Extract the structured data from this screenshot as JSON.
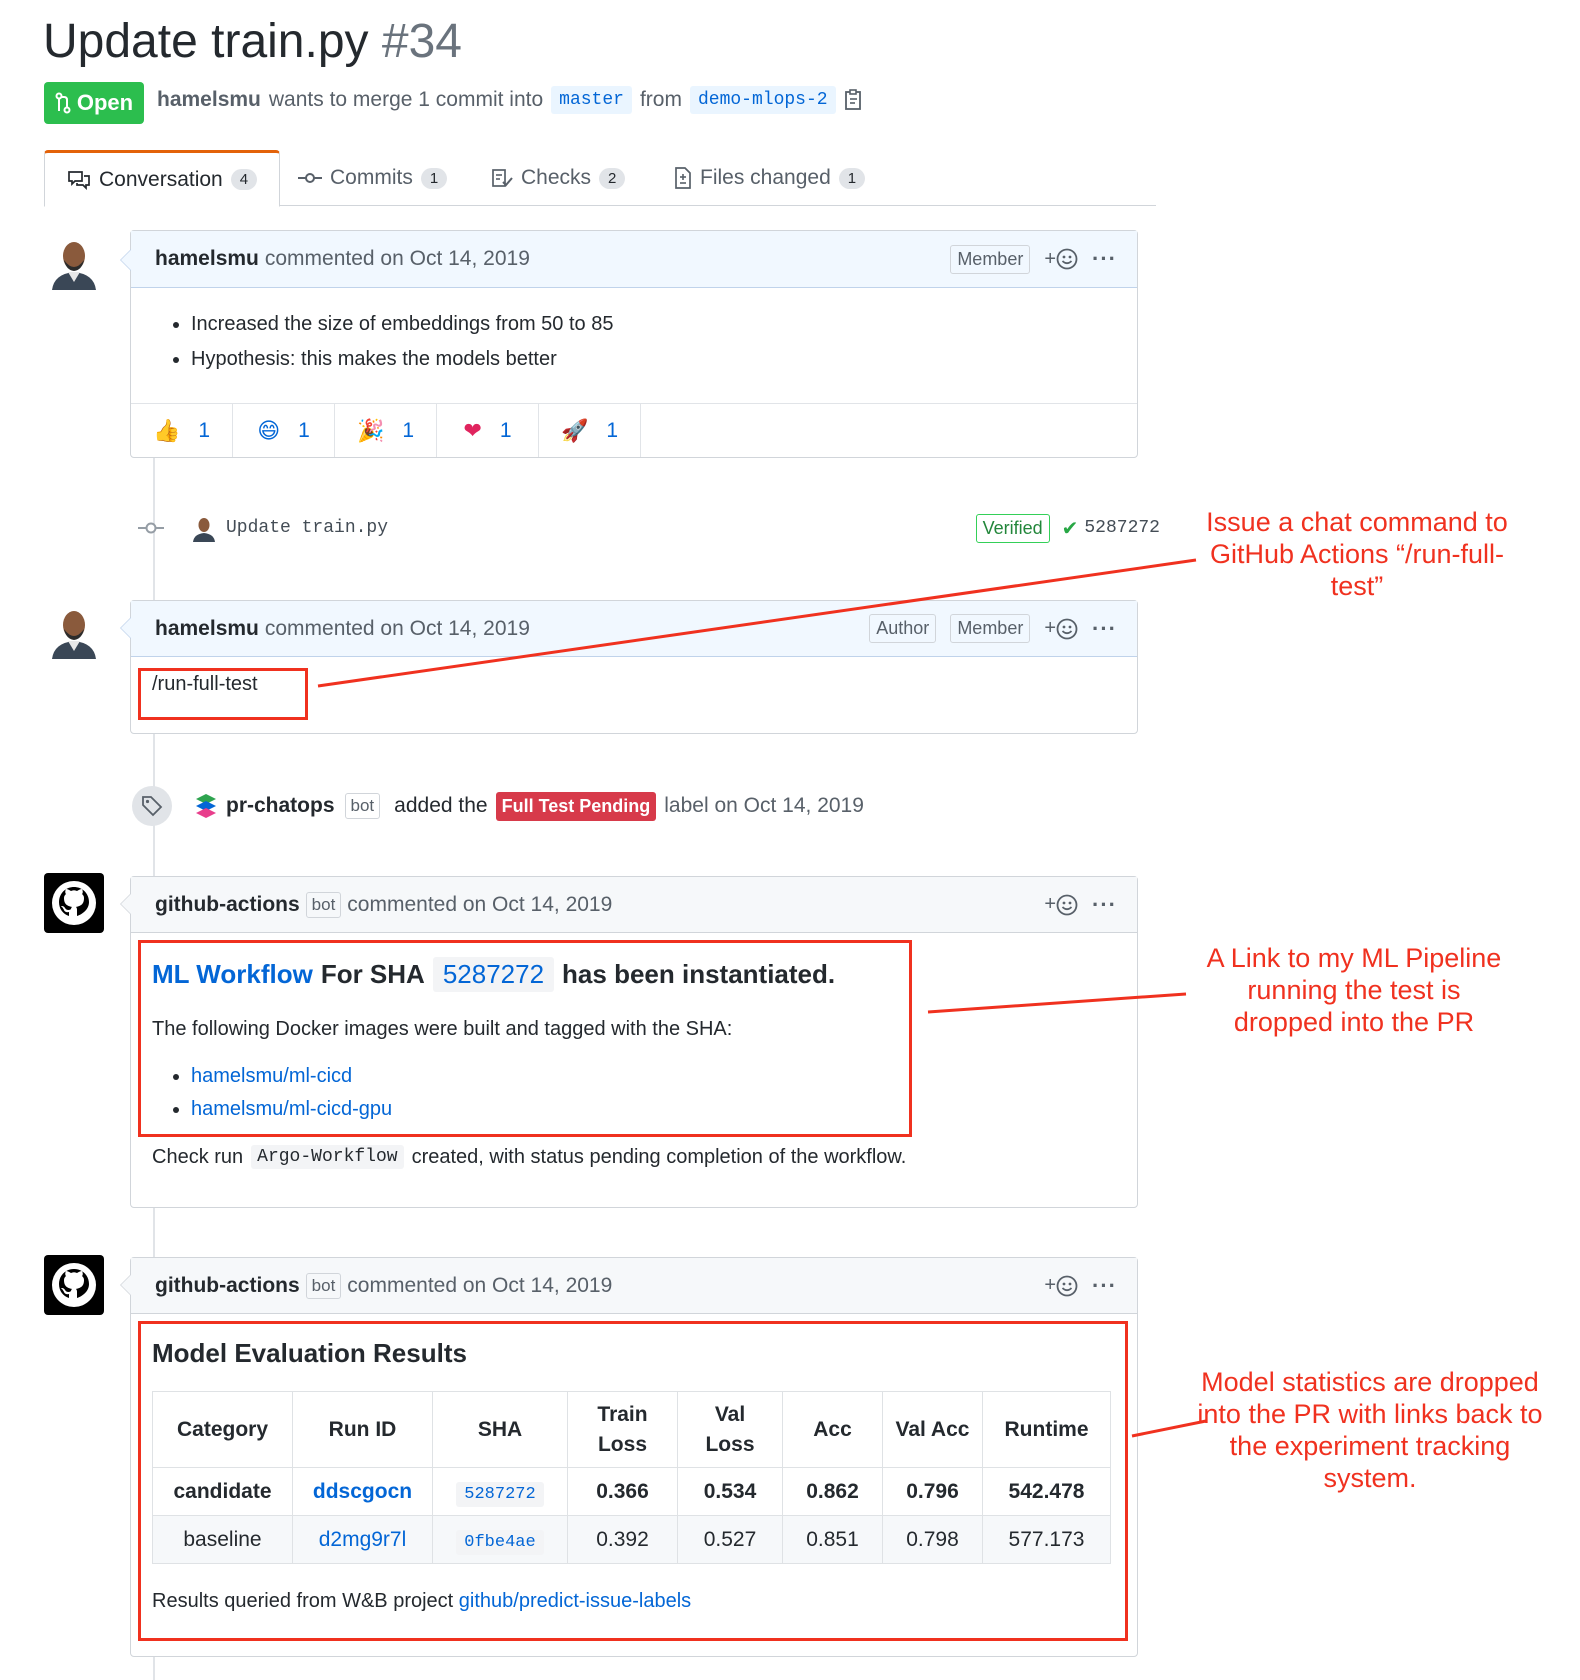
{
  "pr": {
    "title": "Update train.py",
    "number": "#34",
    "state": "Open",
    "author": "hamelsmu",
    "merge_text": "wants to merge 1 commit into",
    "base_branch": "master",
    "from_text": "from",
    "head_branch": "demo-mlops-2"
  },
  "tabs": [
    {
      "label": "Conversation",
      "count": "4"
    },
    {
      "label": "Commits",
      "count": "1"
    },
    {
      "label": "Checks",
      "count": "2"
    },
    {
      "label": "Files changed",
      "count": "1"
    }
  ],
  "comment1": {
    "author": "hamelsmu",
    "meta": "commented on Oct 14, 2019",
    "badge": "Member",
    "bullets": [
      "Increased the size of embeddings from 50 to 85",
      "Hypothesis: this makes the models better"
    ],
    "reactions": [
      {
        "emoji": "👍",
        "count": "1"
      },
      {
        "emoji": "😄",
        "count": "1"
      },
      {
        "emoji": "🎉",
        "count": "1"
      },
      {
        "emoji": "❤",
        "count": "1"
      },
      {
        "emoji": "🚀",
        "count": "1"
      }
    ]
  },
  "commit": {
    "message": "Update train.py",
    "verified": "Verified",
    "sha": "5287272"
  },
  "comment2": {
    "author": "hamelsmu",
    "meta": "commented on Oct 14, 2019",
    "badge_author": "Author",
    "badge_member": "Member",
    "body": "/run-full-test"
  },
  "label_event": {
    "actor": "pr-chatops",
    "bot": "bot",
    "added_text": "added the",
    "label": "Full Test Pending",
    "suffix": "label on Oct 14, 2019"
  },
  "comment3": {
    "author": "github-actions",
    "bot": "bot",
    "meta": "commented on Oct 14, 2019",
    "heading_link": "ML Workflow",
    "heading_mid": "For SHA",
    "heading_sha": "5287272",
    "heading_end": "has been instantiated.",
    "intro": "The following Docker images were built and tagged with the SHA:",
    "images": [
      "hamelsmu/ml-cicd",
      "hamelsmu/ml-cicd-gpu"
    ],
    "check_prefix": "Check run",
    "check_code": "Argo-Workflow",
    "check_suffix": "created, with status pending completion of the workflow."
  },
  "comment4": {
    "author": "github-actions",
    "bot": "bot",
    "meta": "commented on Oct 14, 2019",
    "heading": "Model Evaluation Results",
    "table": {
      "headers": [
        "Category",
        "Run ID",
        "SHA",
        "Train Loss",
        "Val Loss",
        "Acc",
        "Val Acc",
        "Runtime"
      ],
      "rows": [
        [
          "candidate",
          "ddscgocn",
          "5287272",
          "0.366",
          "0.534",
          "0.862",
          "0.796",
          "542.478"
        ],
        [
          "baseline",
          "d2mg9r7l",
          "0fbe4ae",
          "0.392",
          "0.527",
          "0.851",
          "0.798",
          "577.173"
        ]
      ]
    },
    "footer_prefix": "Results queried from W&B project",
    "footer_link": "github/predict-issue-labels"
  },
  "annotations": {
    "a1": "Issue a chat command to GitHub Actions “/run-full-test”",
    "a2": "A Link to my ML Pipeline running the test is dropped into the PR",
    "a3": "Model statistics are dropped into the PR with links back to the experiment tracking system."
  },
  "colors": {
    "open_green": "#2cbe4e",
    "link_blue": "#0366d6",
    "annotation_red": "#f0311f",
    "label_red": "#d73a4a"
  }
}
